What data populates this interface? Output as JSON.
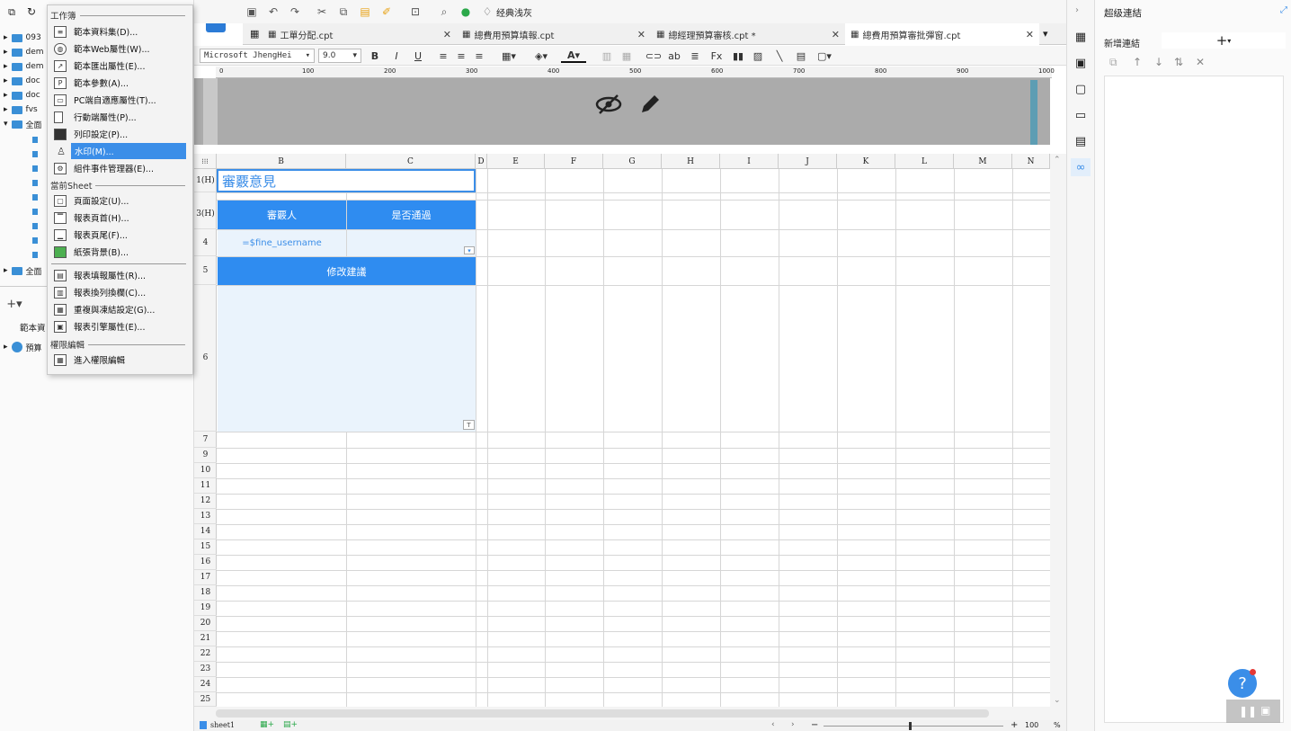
{
  "left_tree": {
    "items": [
      "093",
      "dem",
      "dem",
      "doc",
      "doc",
      "fvs",
      "全面",
      "全面"
    ],
    "bottom_label": "範本資",
    "db_label": "預算"
  },
  "menu": {
    "section_workbook": "工作簿",
    "items_workbook": [
      {
        "label": "範本資料集(D)...",
        "icon": "database-icon"
      },
      {
        "label": "範本Web屬性(W)...",
        "icon": "globe-icon"
      },
      {
        "label": "範本匯出屬性(E)...",
        "icon": "export-icon"
      },
      {
        "label": "範本參數(A)...",
        "icon": "parameter-icon"
      },
      {
        "label": "PC端自適應屬性(T)...",
        "icon": "pc-icon"
      },
      {
        "label": "行動端屬性(P)...",
        "icon": "mobile-icon"
      },
      {
        "label": "列印設定(P)...",
        "icon": "printer-icon"
      },
      {
        "label": "水印(M)...",
        "icon": "watermark-icon"
      },
      {
        "label": "組件事件管理器(E)...",
        "icon": "event-icon"
      }
    ],
    "section_sheet": "當前Sheet",
    "items_sheet": [
      {
        "label": "頁面設定(U)...",
        "icon": "page-icon"
      },
      {
        "label": "報表頁首(H)...",
        "icon": "header-icon"
      },
      {
        "label": "報表頁尾(F)...",
        "icon": "footer-icon"
      },
      {
        "label": "紙張背景(B)...",
        "icon": "image-icon"
      },
      {
        "label": "報表填報屬性(R)...",
        "icon": "fill-icon"
      },
      {
        "label": "報表換列換欄(C)...",
        "icon": "columns-icon"
      },
      {
        "label": "重複與凍結設定(G)...",
        "icon": "freeze-icon"
      },
      {
        "label": "報表引擎屬性(E)...",
        "icon": "engine-icon"
      }
    ],
    "section_perm": "權限編輯",
    "items_perm": [
      {
        "label": "進入權限編輯",
        "icon": "permission-icon"
      }
    ]
  },
  "toolbar": {
    "theme_label": "经典浅灰"
  },
  "tabs": [
    {
      "label": "工單分配.cpt"
    },
    {
      "label": "總費用預算填報.cpt"
    },
    {
      "label": "總經理預算審核.cpt *"
    },
    {
      "label": "總費用預算審批彈窗.cpt"
    }
  ],
  "format": {
    "font": "Microsoft JhengHei",
    "size": "9.0",
    "bold": "B",
    "italic": "I",
    "underline": "U"
  },
  "ruler": [
    "0",
    "100",
    "200",
    "300",
    "400",
    "500",
    "600",
    "700",
    "800",
    "900",
    "1000"
  ],
  "columns": [
    "B",
    "C",
    "D",
    "E",
    "F",
    "G",
    "H",
    "I",
    "J",
    "K",
    "L",
    "M",
    "N"
  ],
  "rows": [
    "1(H)",
    "3(H)",
    "4",
    "5",
    "6",
    "7",
    "9",
    "10",
    "11",
    "12",
    "13",
    "14",
    "15",
    "16",
    "17",
    "18",
    "19",
    "20",
    "21",
    "22",
    "23",
    "24",
    "25"
  ],
  "cells": {
    "title": "審覈意見",
    "approver_header": "審覈人",
    "passed_header": "是否通過",
    "username_formula": "=$fine_username",
    "suggestion_header": "修改建議"
  },
  "right_panel": {
    "title": "超级連結",
    "add_label": "新增連結"
  },
  "status": {
    "sheet": "sheet1",
    "zoom": "100"
  },
  "colors": {
    "accent": "#3b8ee8",
    "header_fill": "#2f8cf0",
    "light_fill": "#eaf3fc"
  }
}
